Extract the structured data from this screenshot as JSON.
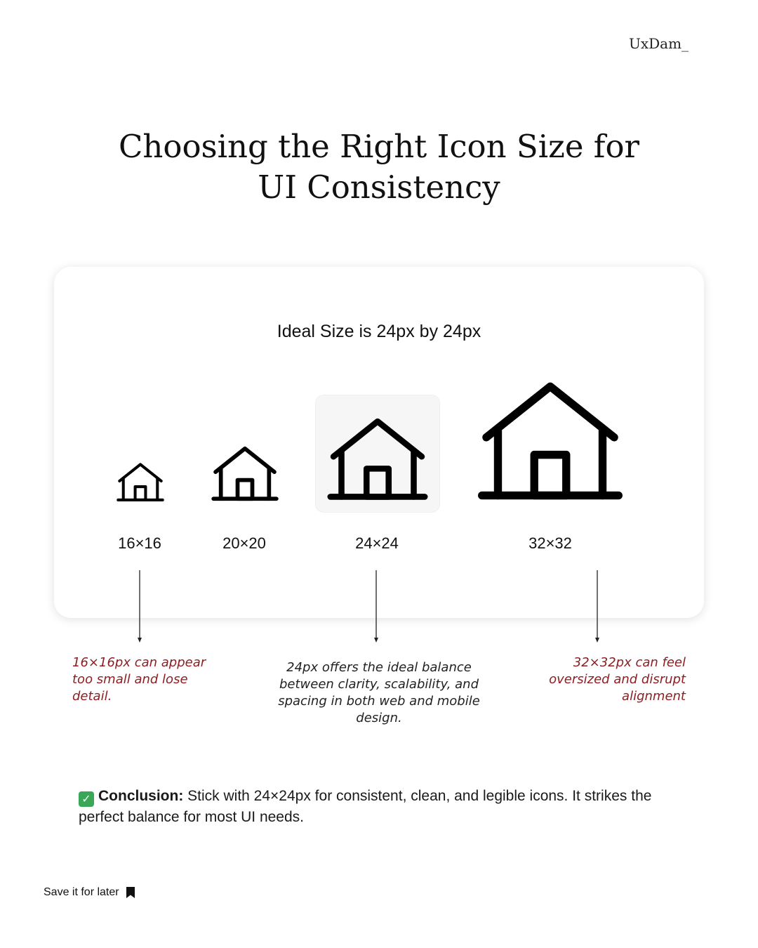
{
  "brand": "UxDam_",
  "title_line1": "Choosing the Right Icon Size for",
  "title_line2": "UI Consistency",
  "card": {
    "heading": "Ideal Size is 24px by 24px",
    "sizes": [
      "16×16",
      "20×20",
      "24×24",
      "32×32"
    ]
  },
  "notes": {
    "small": "16×16px can appear too small and lose detail.",
    "ideal": "24px offers the ideal balance between clarity, scalability, and spacing in both web and mobile design.",
    "large": "32×32px can feel oversized and disrupt alignment"
  },
  "conclusion": {
    "label": "Conclusion:",
    "text": " Stick with 24×24px for consistent, clean, and legible icons. It strikes the perfect balance for most UI needs."
  },
  "save_label": "Save it for later",
  "colors": {
    "note_red": "#8f1e22",
    "check_green": "#3aa757"
  },
  "icons": [
    "home-icon",
    "check-icon",
    "bookmark-icon"
  ]
}
